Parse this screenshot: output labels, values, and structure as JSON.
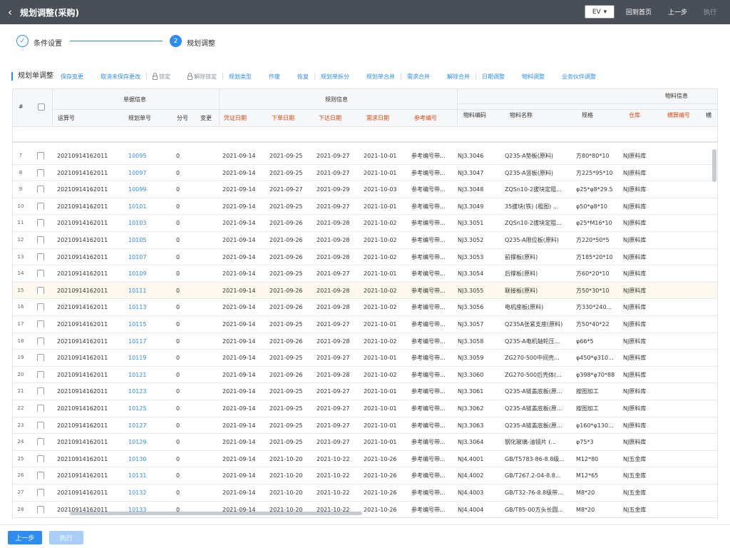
{
  "header": {
    "title": "规划调整(采购)",
    "ev": "EV",
    "back_home": "回到首页",
    "prev": "上一步",
    "execute": "执行"
  },
  "steps": [
    {
      "label": "条件设置",
      "num": "✓"
    },
    {
      "label": "规划调整",
      "num": "2"
    }
  ],
  "toolbar": {
    "title": "规划单调整",
    "items": [
      "保存变更",
      "取消未保存更改",
      "锁定",
      "解除锁定",
      "规划类型",
      "作废",
      "恢复",
      "规划单拆分",
      "规划单合并",
      "需求合并",
      "解除合并",
      "日期调整",
      "物料调整",
      "业务伙伴调整"
    ]
  },
  "grid": {
    "groups": [
      "单据信息",
      "规则信息",
      "物料信息"
    ],
    "columns": [
      "#",
      "运算号",
      "规划单号",
      "分号",
      "变更",
      "凭证日期",
      "下单日期",
      "下达日期",
      "需求日期",
      "参考编号",
      "物料编码",
      "物料名称",
      "规格",
      "仓库",
      "横算编号",
      "横"
    ],
    "rows": [
      {
        "num": "7",
        "calc": "20210914162011",
        "plan": "10095",
        "sub": "0",
        "d1": "2021-09-14",
        "d2": "2021-09-25",
        "d3": "2021-09-27",
        "d4": "2021-10-01",
        "ref": "参考编号带...",
        "code": "NJ3.3046",
        "name": "Q235-A垫板(原料)",
        "spec": "方80*80*10",
        "wh": "NJ原料库"
      },
      {
        "num": "8",
        "calc": "20210914162011",
        "plan": "10097",
        "sub": "0",
        "d1": "2021-09-14",
        "d2": "2021-09-25",
        "d3": "2021-09-27",
        "d4": "2021-10-01",
        "ref": "参考编号带...",
        "code": "NJ3.3047",
        "name": "Q235-A竖板(原料)",
        "spec": "方225*95*10",
        "wh": "NJ原料库"
      },
      {
        "num": "9",
        "calc": "20210914162011",
        "plan": "10099",
        "sub": "0",
        "d1": "2021-09-14",
        "d2": "2021-09-27",
        "d3": "2021-09-29",
        "d4": "2021-10-03",
        "ref": "参考编号带...",
        "code": "NJ3.3048",
        "name": "ZQSn10-2拔块定阻...",
        "spec": "φ25*φ8*29.5",
        "wh": "NJ原料库"
      },
      {
        "num": "10",
        "calc": "20210914162011",
        "plan": "10101",
        "sub": "0",
        "d1": "2021-09-14",
        "d2": "2021-09-25",
        "d3": "2021-09-27",
        "d4": "2021-10-01",
        "ref": "参考编号带...",
        "code": "NJ3.3049",
        "name": "35拔块(铁) (粗图) ...",
        "spec": "φ50*φ8*10",
        "wh": "NJ原料库"
      },
      {
        "num": "11",
        "calc": "20210914162011",
        "plan": "10103",
        "sub": "0",
        "d1": "2021-09-14",
        "d2": "2021-09-26",
        "d3": "2021-09-28",
        "d4": "2021-10-02",
        "ref": "参考编号带...",
        "code": "NJ3.3051",
        "name": "ZQSn10-2拔块定阻...",
        "spec": "φ25*M16*10",
        "wh": "NJ原料库"
      },
      {
        "num": "12",
        "calc": "20210914162011",
        "plan": "10105",
        "sub": "0",
        "d1": "2021-09-14",
        "d2": "2021-09-26",
        "d3": "2021-09-28",
        "d4": "2021-10-02",
        "ref": "参考编号带...",
        "code": "NJ3.3052",
        "name": "Q235-A限位板(原料)",
        "spec": "方220*50*5",
        "wh": "NJ原料库"
      },
      {
        "num": "13",
        "calc": "20210914162011",
        "plan": "10107",
        "sub": "0",
        "d1": "2021-09-14",
        "d2": "2021-09-26",
        "d3": "2021-09-28",
        "d4": "2021-10-02",
        "ref": "参考编号带...",
        "code": "NJ3.3053",
        "name": "前撑板(原料)",
        "spec": "方185*20*10",
        "wh": "NJ原料库"
      },
      {
        "num": "14",
        "calc": "20210914162011",
        "plan": "10109",
        "sub": "0",
        "d1": "2021-09-14",
        "d2": "2021-09-25",
        "d3": "2021-09-27",
        "d4": "2021-10-01",
        "ref": "参考编号带...",
        "code": "NJ3.3054",
        "name": "后撑板(原料)",
        "spec": "方60*20*10",
        "wh": "NJ原料库"
      },
      {
        "num": "15",
        "calc": "20210914162011",
        "plan": "10111",
        "sub": "0",
        "d1": "2021-09-14",
        "d2": "2021-09-26",
        "d3": "2021-09-28",
        "d4": "2021-10-02",
        "ref": "参考编号带...",
        "code": "NJ3.3055",
        "name": "联接板(原料)",
        "spec": "方50*30*10",
        "wh": "NJ原料库",
        "hl": true
      },
      {
        "num": "16",
        "calc": "20210914162011",
        "plan": "10113",
        "sub": "0",
        "d1": "2021-09-14",
        "d2": "2021-09-26",
        "d3": "2021-09-28",
        "d4": "2021-10-02",
        "ref": "参考编号带...",
        "code": "NJ3.3056",
        "name": "电机座板(原料)",
        "spec": "方330*240...",
        "wh": "NJ原料库"
      },
      {
        "num": "17",
        "calc": "20210914162011",
        "plan": "10115",
        "sub": "0",
        "d1": "2021-09-14",
        "d2": "2021-09-25",
        "d3": "2021-09-27",
        "d4": "2021-10-01",
        "ref": "参考编号带...",
        "code": "NJ3.3057",
        "name": "Q235A张紧支座(原料)",
        "spec": "方50*40*22",
        "wh": "NJ原料库"
      },
      {
        "num": "18",
        "calc": "20210914162011",
        "plan": "10117",
        "sub": "0",
        "d1": "2021-09-14",
        "d2": "2021-09-26",
        "d3": "2021-09-28",
        "d4": "2021-10-02",
        "ref": "参考编号带...",
        "code": "NJ3.3058",
        "name": "Q235-A电机轴轮压...",
        "spec": "φ66*5",
        "wh": "NJ原料库"
      },
      {
        "num": "19",
        "calc": "20210914162011",
        "plan": "10119",
        "sub": "0",
        "d1": "2021-09-14",
        "d2": "2021-09-25",
        "d3": "2021-09-27",
        "d4": "2021-10-01",
        "ref": "参考编号带...",
        "code": "NJ3.3059",
        "name": "ZG270-500中间壳...",
        "spec": "φ450*φ310...",
        "wh": "NJ原料库"
      },
      {
        "num": "20",
        "calc": "20210914162011",
        "plan": "10121",
        "sub": "0",
        "d1": "2021-09-14",
        "d2": "2021-09-26",
        "d3": "2021-09-28",
        "d4": "2021-10-02",
        "ref": "参考编号带...",
        "code": "NJ3.3060",
        "name": "ZG270-500后壳体(...",
        "spec": "φ398*φ70*88",
        "wh": "NJ原料库"
      },
      {
        "num": "21",
        "calc": "20210914162011",
        "plan": "10123",
        "sub": "0",
        "d1": "2021-09-14",
        "d2": "2021-09-25",
        "d3": "2021-09-27",
        "d4": "2021-10-01",
        "ref": "参考编号带...",
        "code": "NJ3.3061",
        "name": "Q235-A链盖底板(原...",
        "spec": "按图加工",
        "wh": "NJ原料库"
      },
      {
        "num": "22",
        "calc": "20210914162011",
        "plan": "10125",
        "sub": "0",
        "d1": "2021-09-14",
        "d2": "2021-09-25",
        "d3": "2021-09-27",
        "d4": "2021-10-01",
        "ref": "参考编号带...",
        "code": "NJ3.3062",
        "name": "Q235-A链盖底板(原...",
        "spec": "按图加工",
        "wh": "NJ原料库"
      },
      {
        "num": "23",
        "calc": "20210914162011",
        "plan": "10127",
        "sub": "0",
        "d1": "2021-09-14",
        "d2": "2021-09-25",
        "d3": "2021-09-27",
        "d4": "2021-10-01",
        "ref": "参考编号带...",
        "code": "NJ3.3063",
        "name": "Q235-A链盖底板(原...",
        "spec": "φ160*φ130...",
        "wh": "NJ原料库"
      },
      {
        "num": "24",
        "calc": "20210914162011",
        "plan": "10129",
        "sub": "0",
        "d1": "2021-09-14",
        "d2": "2021-09-25",
        "d3": "2021-09-27",
        "d4": "2021-10-01",
        "ref": "参考编号带...",
        "code": "NJ3.3064",
        "name": "钢化玻璃-油镜片 (...",
        "spec": "φ75*3",
        "wh": "NJ原料库"
      },
      {
        "num": "25",
        "calc": "20210914162011",
        "plan": "10130",
        "sub": "0",
        "d1": "2021-09-14",
        "d2": "2021-10-20",
        "d3": "2021-10-22",
        "d4": "2021-10-26",
        "ref": "参考编号带...",
        "code": "NJ4.4001",
        "name": "GB/T5783-86-8.8级...",
        "spec": "M12*80",
        "wh": "NJ五金库"
      },
      {
        "num": "26",
        "calc": "20210914162011",
        "plan": "10131",
        "sub": "0",
        "d1": "2021-09-14",
        "d2": "2021-10-20",
        "d3": "2021-10-22",
        "d4": "2021-10-26",
        "ref": "参考编号带...",
        "code": "NJ4.4002",
        "name": "GB/T267.2-04-8.8...",
        "spec": "M12*65",
        "wh": "NJ五金库"
      },
      {
        "num": "27",
        "calc": "20210914162011",
        "plan": "10132",
        "sub": "0",
        "d1": "2021-09-14",
        "d2": "2021-10-20",
        "d3": "2021-10-22",
        "d4": "2021-10-26",
        "ref": "参考编号带...",
        "code": "NJ4.4003",
        "name": "GB/T32-76-8.8级带...",
        "spec": "M8*20",
        "wh": "NJ五金库"
      },
      {
        "num": "28",
        "calc": "20210914162011",
        "plan": "10133",
        "sub": "0",
        "d1": "2021-09-14",
        "d2": "2021-10-20",
        "d3": "2021-10-22",
        "d4": "2021-10-26",
        "ref": "参考编号带...",
        "code": "NJ4.4004",
        "name": "GB/T85-00方头长圆...",
        "spec": "M8*20",
        "wh": "NJ五金库"
      }
    ]
  },
  "footer": {
    "prev": "上一步",
    "execute": "执行"
  },
  "colors": {
    "topbar": "#4a4f57",
    "accent": "#2d8cf0",
    "required": "#d9480f"
  }
}
